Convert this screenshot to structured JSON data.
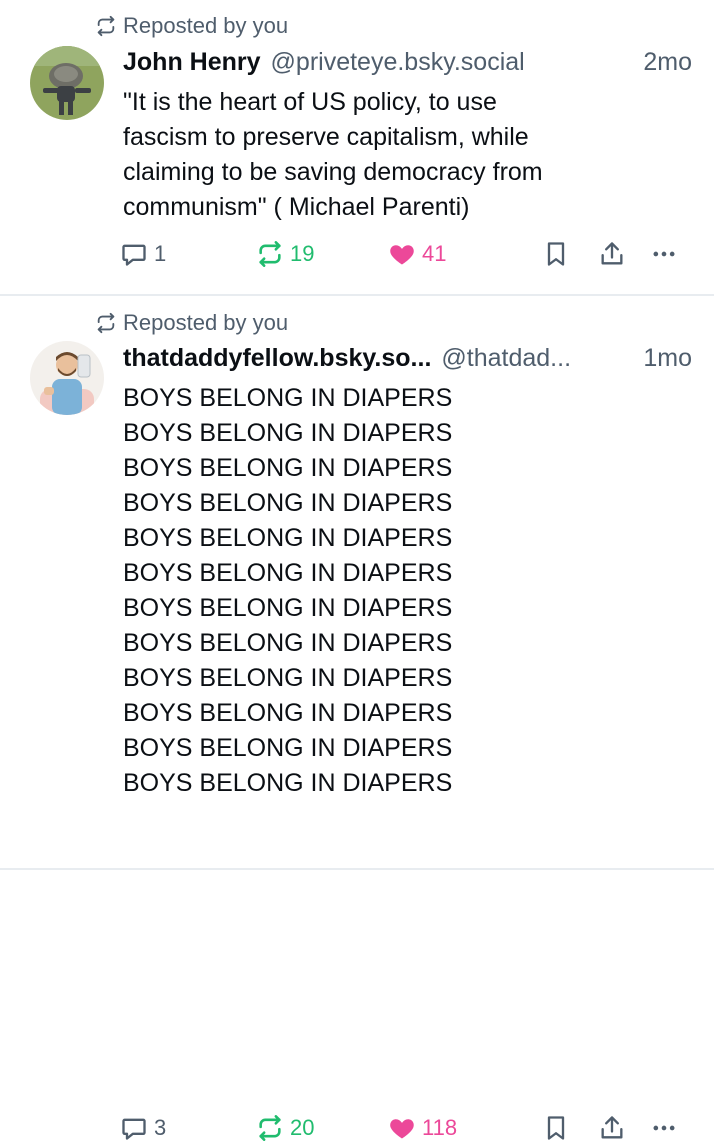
{
  "posts": [
    {
      "repost_label": "Reposted by you",
      "author_name": "John Henry",
      "author_handle": "@priveteye.bsky.social",
      "time": "2mo",
      "text_lines": [
        "\"It is the heart of US policy, to use",
        "fascism to preserve capitalism, while",
        "claiming to be saving democracy from",
        "communism\" ( Michael Parenti)"
      ],
      "reply_count": "1",
      "repost_count": "19",
      "like_count": "41"
    },
    {
      "repost_label": "Reposted by you",
      "author_name": "thatdaddyfellow.bsky.so...",
      "author_handle": "@thatdad...",
      "time": "1mo",
      "text_lines": [
        "BOYS BELONG IN DIAPERS",
        "BOYS BELONG IN DIAPERS",
        "BOYS BELONG IN DIAPERS",
        "BOYS BELONG IN DIAPERS",
        "BOYS BELONG IN DIAPERS",
        "BOYS BELONG IN DIAPERS",
        "BOYS BELONG IN DIAPERS",
        "BOYS BELONG IN DIAPERS",
        "BOYS BELONG IN DIAPERS",
        "BOYS BELONG IN DIAPERS",
        "BOYS BELONG IN DIAPERS",
        "BOYS BELONG IN DIAPERS"
      ],
      "reply_count": "3",
      "repost_count": "20",
      "like_count": "118"
    }
  ],
  "colors": {
    "muted": "#4f5d6c",
    "repost_green": "#20bc6e",
    "like_pink": "#ec4899",
    "divider": "#e8ecf0"
  },
  "icons": [
    "repost-icon",
    "reply-icon",
    "like-heart-icon",
    "bookmark-icon",
    "share-icon",
    "more-icon"
  ]
}
